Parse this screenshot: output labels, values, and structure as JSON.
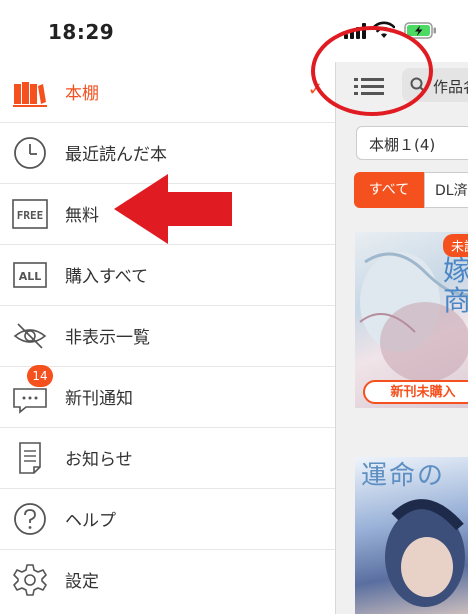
{
  "status_bar": {
    "time": "18:29"
  },
  "menu": {
    "items": [
      {
        "label": "本棚",
        "icon": "bookshelf-icon",
        "active": true,
        "checked": true
      },
      {
        "label": "最近読んだ本",
        "icon": "clock-icon"
      },
      {
        "label": "無料",
        "icon": "free-icon",
        "icon_text": "FREE"
      },
      {
        "label": "購入すべて",
        "icon": "all-icon",
        "icon_text": "ALL"
      },
      {
        "label": "非表示一覧",
        "icon": "eye-off-icon"
      },
      {
        "label": "新刊通知",
        "icon": "chat-bubble-icon",
        "badge": "14"
      },
      {
        "label": "お知らせ",
        "icon": "document-icon"
      },
      {
        "label": "ヘルプ",
        "icon": "help-icon"
      },
      {
        "label": "設定",
        "icon": "gear-icon"
      }
    ]
  },
  "background": {
    "search_text": "作品名",
    "shelf_select": "本棚１(4)",
    "tabs": [
      "すべて",
      "DL済"
    ],
    "cover1": {
      "tag": "未読",
      "banner": "新刊未購入",
      "title": "嫁\n商"
    },
    "cover2": {
      "title": "運命の"
    }
  },
  "colors": {
    "accent": "#f4511e",
    "annotation": "#e01b22"
  }
}
